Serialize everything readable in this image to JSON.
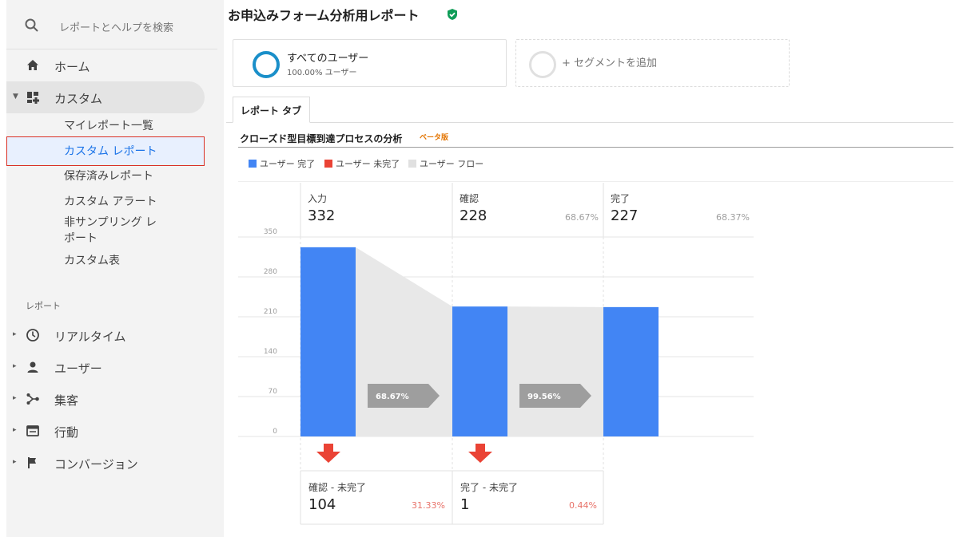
{
  "sidebar": {
    "search_placeholder": "レポートとヘルプを検索",
    "home": "ホーム",
    "custom": "カスタム",
    "custom_children": [
      "マイレポート一覧",
      "カスタム レポート",
      "保存済みレポート",
      "カスタム アラート",
      "非サンプリング レ",
      "ポート",
      "カスタム表"
    ],
    "section_label": "レポート",
    "reports": [
      {
        "label": "リアルタイム",
        "icon": "clock-icon"
      },
      {
        "label": "ユーザー",
        "icon": "person-icon"
      },
      {
        "label": "集客",
        "icon": "acquisition-icon"
      },
      {
        "label": "行動",
        "icon": "behavior-icon"
      },
      {
        "label": "コンバージョン",
        "icon": "flag-icon"
      }
    ],
    "selected_item": "カスタム レポート",
    "accent_color": "#1a73e8"
  },
  "header": {
    "title": "お申込みフォーム分析用レポート",
    "verified_icon": "check-shield-icon",
    "verified_color": "#0f9d58"
  },
  "segments": {
    "all_users_name": "すべてのユーザー",
    "all_users_sub": "100.00% ユーザー",
    "add_segment": "+ セグメントを追加"
  },
  "tabs": [
    "レポート タブ"
  ],
  "analysis": {
    "title": "クローズド型目標到達プロセスの分析",
    "badge": "ベータ版",
    "legend": [
      {
        "label": "ユーザー 完了",
        "color": "#4285f4"
      },
      {
        "label": "ユーザー 未完了",
        "color": "#ea4335"
      },
      {
        "label": "ユーザー フロー",
        "color": "#e0e0e0"
      }
    ]
  },
  "chart_data": {
    "type": "bar",
    "categories": [
      "入力",
      "確認",
      "完了"
    ],
    "series": [
      {
        "name": "ユーザー 完了",
        "values": [
          332,
          228,
          227
        ]
      }
    ],
    "stage_percent": [
      "",
      "68.67%",
      "68.37%"
    ],
    "flow_percent": [
      "68.67%",
      "99.56%"
    ],
    "yticks": [
      350,
      280,
      210,
      140,
      70,
      0
    ],
    "ylim": [
      0,
      350
    ],
    "dropoffs": [
      {
        "label": "確認 - 未完了",
        "value": "104",
        "percent": "31.33%"
      },
      {
        "label": "完了 - 未完了",
        "value": "1",
        "percent": "0.44%"
      }
    ],
    "colors": {
      "complete": "#4285f4",
      "dropoff": "#ea4335",
      "flow": "#e8e8e8",
      "flow_arrow": "#9e9e9e"
    }
  }
}
